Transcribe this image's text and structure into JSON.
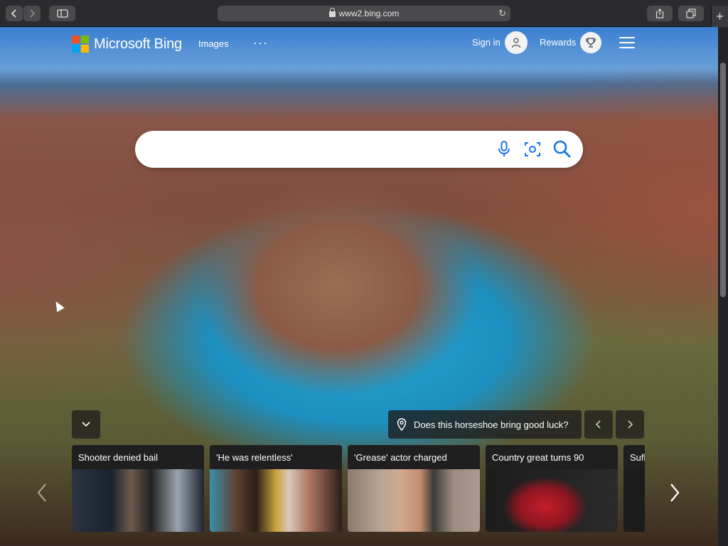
{
  "browser": {
    "url": "www2.bing.com",
    "new_tab_label": "+"
  },
  "header": {
    "logo_text": "Microsoft Bing",
    "nav_images": "Images",
    "nav_more": "···",
    "sign_in": "Sign in",
    "rewards": "Rewards"
  },
  "search": {
    "placeholder": "",
    "value": ""
  },
  "image_caption": "Does this horseshoe bring good luck?",
  "news_cards": [
    {
      "title": "Shooter denied bail"
    },
    {
      "title": "'He was relentless'"
    },
    {
      "title": "'Grease' actor charged"
    },
    {
      "title": "Country great turns 90"
    },
    {
      "title": "Sufl"
    }
  ],
  "colors": {
    "bing_logo": [
      "#f25022",
      "#7fba00",
      "#00a4ef",
      "#ffb900"
    ],
    "search_icon": "#1a73e8"
  }
}
